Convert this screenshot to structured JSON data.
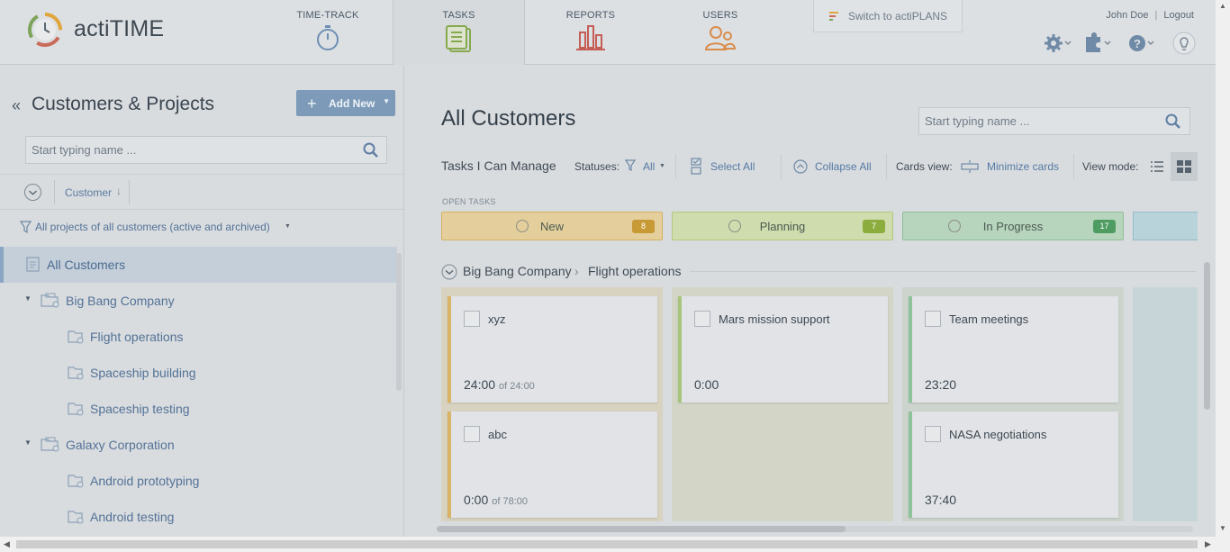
{
  "brand": {
    "name": "actiTIME"
  },
  "nav": {
    "time_track": "TIME-TRACK",
    "tasks": "TASKS",
    "reports": "REPORTS",
    "users": "USERS",
    "switch_actiplans": "Switch to actiPLANS"
  },
  "user": {
    "name": "John Doe",
    "separator": "|",
    "logout": "Logout"
  },
  "left": {
    "title": "Customers & Projects",
    "add_new": "Add New",
    "search_placeholder": "Start typing name ...",
    "sort_label": "Customer",
    "filter_label": "All projects of all customers (active and archived)",
    "tree": [
      {
        "label": "All Customers",
        "level": 0,
        "selected": true
      },
      {
        "label": "Big Bang Company",
        "level": 1
      },
      {
        "label": "Flight operations",
        "level": 2
      },
      {
        "label": "Spaceship building",
        "level": 2
      },
      {
        "label": "Spaceship testing",
        "level": 2
      },
      {
        "label": "Galaxy Corporation",
        "level": 1
      },
      {
        "label": "Android prototyping",
        "level": 2
      },
      {
        "label": "Android testing",
        "level": 2
      }
    ]
  },
  "main": {
    "title": "All Customers",
    "search_placeholder": "Start typing name ...",
    "toolbar": {
      "tasks_label": "Tasks I Can Manage",
      "statuses_label": "Statuses:",
      "statuses_value": "All",
      "select_all": "Select All",
      "collapse_all": "Collapse All",
      "cards_view_label": "Cards view:",
      "minimize_cards": "Minimize cards",
      "view_mode_label": "View mode:"
    },
    "open_tasks_label": "OPEN TASKS",
    "columns": [
      {
        "name": "New",
        "count": "8",
        "bg": "#e4cf9c",
        "border": "#d4b060",
        "badge": "#c79a35"
      },
      {
        "name": "Planning",
        "count": "7",
        "bg": "#cfdcae",
        "border": "#b2c87c",
        "badge": "#8cad3d"
      },
      {
        "name": "In Progress",
        "count": "17",
        "bg": "#b7d4bd",
        "border": "#8fbf9a",
        "badge": "#4f9c62"
      }
    ],
    "group": {
      "customer": "Big Bang Company",
      "separator": "›",
      "project": "Flight operations"
    },
    "cards": [
      {
        "name": "xyz",
        "time": "24:00",
        "of": "of 24:00"
      },
      {
        "name": "abc",
        "time": "0:00",
        "of": "of 78:00"
      },
      {
        "name": "Mars mission support",
        "time": "0:00",
        "of": ""
      },
      {
        "name": "Team meetings",
        "time": "23:20",
        "of": ""
      },
      {
        "name": "NASA negotiations",
        "time": "37:40",
        "of": ""
      }
    ]
  },
  "colors": {
    "accent": "#5479a3",
    "button": "#7d9bb8",
    "selection": "#c4cfda"
  }
}
